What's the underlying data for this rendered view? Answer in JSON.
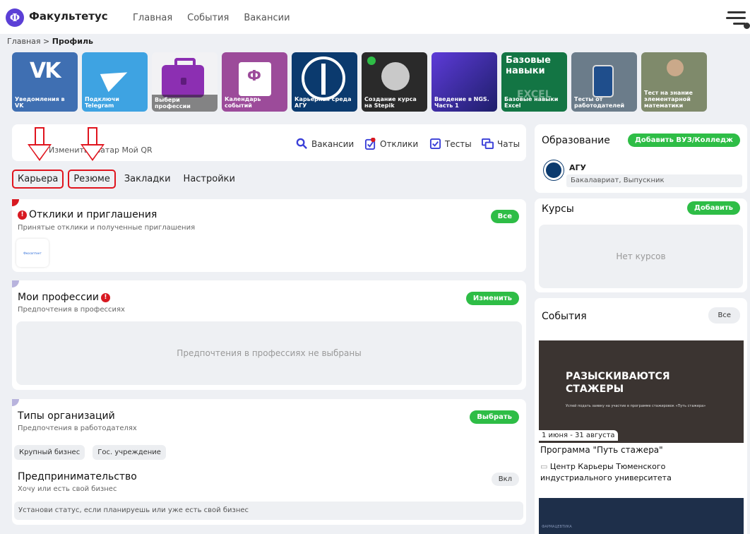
{
  "header": {
    "logo_letter": "Ф",
    "brand": "Факультетус",
    "nav": [
      "Главная",
      "События",
      "Вакансии"
    ]
  },
  "breadcrumb": {
    "home": "Главная",
    "sep": ">",
    "current": "Профиль"
  },
  "stories": [
    "Уведомления в VK",
    "Подключи Telegram",
    "Выбери профессии",
    "Календарь событий",
    "Карьерная среда АГУ",
    "Создание курса на Stepik",
    "Введение в NGS. Часть 1",
    "Базовые навыки Excel",
    "Тесты от работодателей",
    "Тест на знание элементарной математики"
  ],
  "story_excel": {
    "title": "Базовые навыки",
    "mid": "EXCEL"
  },
  "actions": {
    "avatar_text": "Изменить аватар  Мой QR",
    "vacancies": "Вакансии",
    "responses": "Отклики",
    "tests": "Тесты",
    "chats": "Чаты"
  },
  "tabs": [
    "Карьера",
    "Резюме",
    "Закладки",
    "Настройки"
  ],
  "responses_section": {
    "badge": "!",
    "title": "Отклики и приглашения",
    "subtitle": "Принятые отклики и полученные приглашения",
    "button": "Все",
    "company_logo_text": "Фкосоптинт"
  },
  "professions_section": {
    "badge": "!",
    "title": "Мои профессии",
    "subtitle": "Предпочтения в профессиях",
    "button": "Изменить",
    "empty": "Предпочтения в профессиях не выбраны"
  },
  "orgs_section": {
    "title": "Типы организаций",
    "subtitle": "Предпочтения в работодателях",
    "button": "Выбрать",
    "chips": [
      "Крупный бизнес",
      "Гос. учреждение"
    ],
    "ent_title": "Предпринимательство",
    "ent_sub": "Хочу или есть свой бизнес",
    "ent_button": "Вкл",
    "ent_hint": "Установи статус, если планируешь или уже есть свой бизнес"
  },
  "education": {
    "title": "Образование",
    "button": "Добавить ВУЗ/Колледж",
    "uni": "АГУ",
    "degree": "Бакалавриат, Выпускник"
  },
  "courses": {
    "title": "Курсы",
    "button": "Добавить",
    "empty": "Нет курсов"
  },
  "events": {
    "title": "События",
    "button": "Все",
    "image_title": "РАЗЫСКИВАЮТСЯ СТАЖЕРЫ",
    "image_small": "Успей подать заявку на участие в программе стажировок «Путь стажера»",
    "date": "1 июня - 31 августа",
    "name": "Программа \"Путь стажера\"",
    "org": "Центр Карьеры Тюменского индустриального университета",
    "next_image_text": "ФАРМАЦЕВТИКА"
  },
  "colors": {
    "green": "#2ebd46",
    "red": "#d81921",
    "annotation": "#e0141e",
    "accent": "#5b3fd6"
  }
}
